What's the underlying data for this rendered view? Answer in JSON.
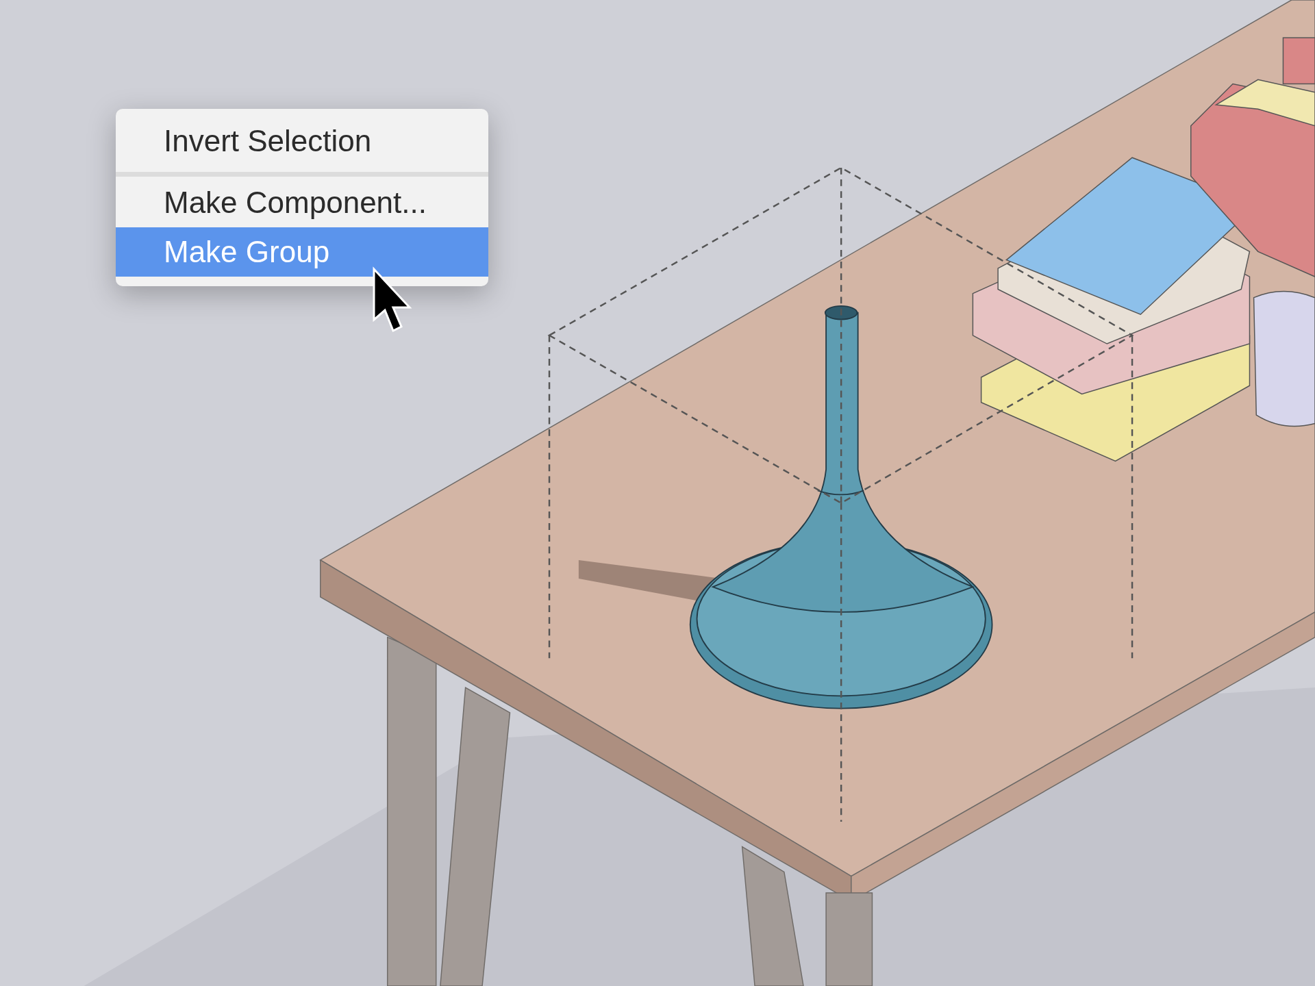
{
  "context_menu": {
    "items": [
      {
        "kind": "item",
        "label": "Invert Selection",
        "selected": false
      },
      {
        "kind": "separator"
      },
      {
        "kind": "item",
        "label": "Make Component...",
        "selected": false
      },
      {
        "kind": "item",
        "label": "Make Group",
        "selected": true
      }
    ]
  }
}
